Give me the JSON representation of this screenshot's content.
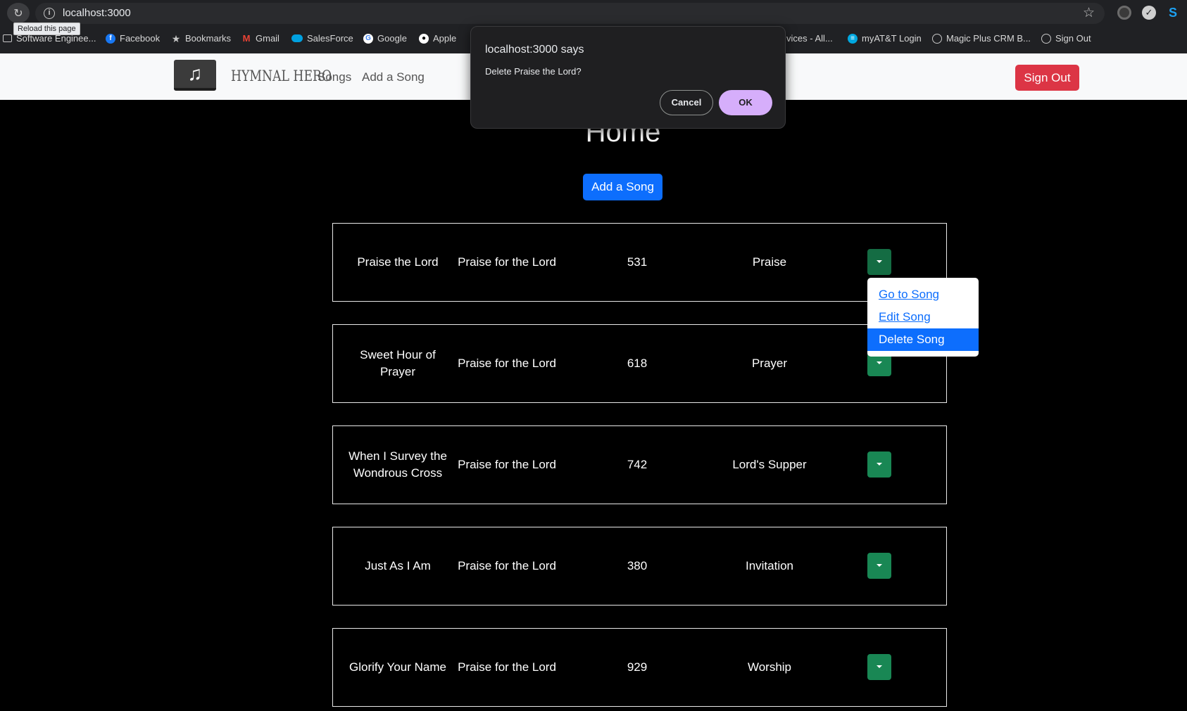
{
  "browser": {
    "url": "localhost:3000",
    "tooltip": "Reload this page",
    "bookmarks": [
      {
        "label": "Software Enginee...",
        "icon": "folder-icon"
      },
      {
        "label": "Facebook",
        "icon": "facebook-icon"
      },
      {
        "label": "Bookmarks",
        "icon": "star-icon"
      },
      {
        "label": "Gmail",
        "icon": "gmail-icon"
      },
      {
        "label": "SalesForce",
        "icon": "salesforce-icon"
      },
      {
        "label": "Google",
        "icon": "google-icon"
      },
      {
        "label": "Apple",
        "icon": "apple-icon"
      },
      {
        "label": "vices - All...",
        "icon": "none"
      },
      {
        "label": "myAT&T Login",
        "icon": "att-icon"
      },
      {
        "label": "Magic Plus CRM B...",
        "icon": "globe-icon"
      },
      {
        "label": "Sign Out",
        "icon": "globe-icon"
      }
    ]
  },
  "navbar": {
    "brand": "HYMNAL HERO",
    "links": [
      "Songs",
      "Add a Song"
    ],
    "signout_label": "Sign Out"
  },
  "main": {
    "title": "Home",
    "add_button": "Add a Song"
  },
  "songs": [
    {
      "title": "Praise the Lord",
      "book": "Praise for the Lord",
      "number": "531",
      "category": "Praise"
    },
    {
      "title": "Sweet Hour of Prayer",
      "book": "Praise for the Lord",
      "number": "618",
      "category": "Prayer"
    },
    {
      "title": "When I Survey the Wondrous Cross",
      "book": "Praise for the Lord",
      "number": "742",
      "category": "Lord's Supper"
    },
    {
      "title": "Just As I Am",
      "book": "Praise for the Lord",
      "number": "380",
      "category": "Invitation"
    },
    {
      "title": "Glorify Your Name",
      "book": "Praise for the Lord",
      "number": "929",
      "category": "Worship"
    }
  ],
  "dropdown_menu": {
    "items": [
      "Go to Song",
      "Edit Song",
      "Delete Song"
    ],
    "active_index": 2
  },
  "dialog": {
    "title": "localhost:3000 says",
    "message": "Delete Praise the Lord?",
    "cancel_label": "Cancel",
    "ok_label": "OK"
  },
  "colors": {
    "primary": "#0d6efd",
    "danger": "#dc3545",
    "success": "#198754",
    "dialog_ok": "#d6aefb"
  }
}
